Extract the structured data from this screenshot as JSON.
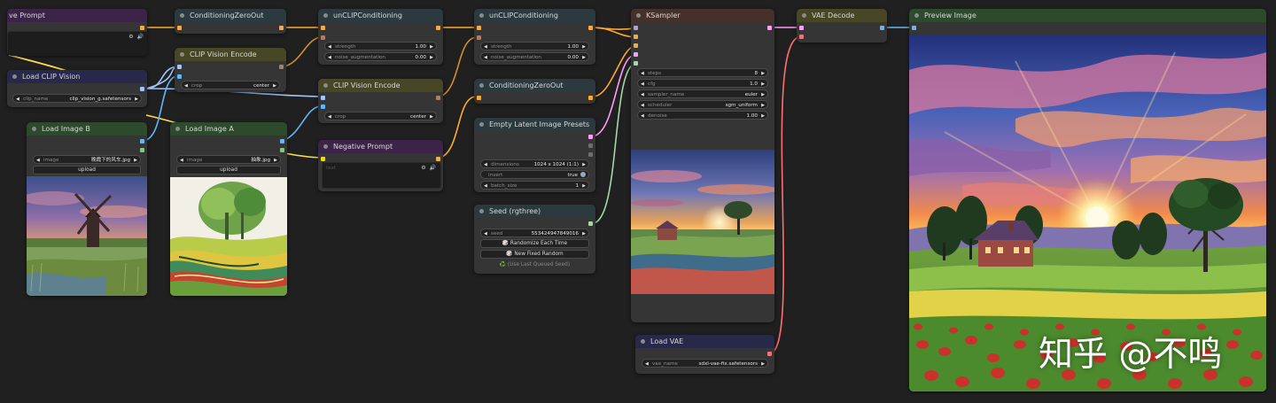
{
  "colors": {
    "canvas_bg": "#202020",
    "node_bg": "#353535",
    "wire_conditioning": "#ffa931",
    "wire_clip_vision": "#a1c5f5",
    "wire_image": "#64b5f6",
    "wire_latent": "#ff9cf9",
    "wire_vae": "#ff6e6e",
    "wire_int": "#a5d6a7",
    "wire_model": "#b39ddb"
  },
  "nodes": {
    "positive_prompt": {
      "title": "ve Prompt",
      "icons": "⚙ 🔊"
    },
    "load_clip_vision": {
      "title": "Load CLIP Vision",
      "clip_name_label": "clip_name",
      "clip_name_value": "clip_vision_g.safetensors"
    },
    "load_image_b": {
      "title": "Load Image B",
      "image_label": "image",
      "image_value": "晚霞下的风车.jpg",
      "upload_label": "upload"
    },
    "load_image_a": {
      "title": "Load Image A",
      "image_label": "image",
      "image_value": "抽象.jpg",
      "upload_label": "upload"
    },
    "conditioning_zero_out_1": {
      "title": "ConditioningZeroOut"
    },
    "clip_vision_encode_1": {
      "title": "CLIP Vision Encode",
      "crop_label": "crop",
      "crop_value": "center"
    },
    "unclip_conditioning_1": {
      "title": "unCLIPConditioning",
      "strength_label": "strength",
      "strength_value": "1.00",
      "noise_label": "noise_augmentation",
      "noise_value": "0.00"
    },
    "clip_vision_encode_2": {
      "title": "CLIP Vision Encode",
      "crop_label": "crop",
      "crop_value": "center"
    },
    "negative_prompt": {
      "title": "Negative Prompt",
      "placeholder": "text",
      "icons": "⚙ 🔊"
    },
    "unclip_conditioning_2": {
      "title": "unCLIPConditioning",
      "strength_label": "strength",
      "strength_value": "1.00",
      "noise_label": "noise_augmentation",
      "noise_value": "0.00"
    },
    "conditioning_zero_out_2": {
      "title": "ConditioningZeroOut"
    },
    "empty_latent": {
      "title": "Empty Latent Image Presets",
      "dimensions_label": "dimensions",
      "dimensions_value": "1024 x 1024 (1:1)",
      "invert_label": "invert",
      "invert_value": "true",
      "batch_label": "batch_size",
      "batch_value": "1"
    },
    "seed": {
      "title": "Seed (rgthree)",
      "seed_label": "seed",
      "seed_value": "553424947849016",
      "randomize_label": "🎲 Randomize Each Time",
      "fixed_label": "🎲 New Fixed Random",
      "last_label": "♻️ (Use Last Queued Seed)"
    },
    "ksampler": {
      "title": "KSampler",
      "steps_label": "steps",
      "steps_value": "8",
      "cfg_label": "cfg",
      "cfg_value": "1.0",
      "sampler_label": "sampler_name",
      "sampler_value": "euler",
      "scheduler_label": "scheduler",
      "scheduler_value": "sgm_uniform",
      "denoise_label": "denoise",
      "denoise_value": "1.00"
    },
    "load_vae": {
      "title": "Load VAE",
      "vae_label": "vae_name",
      "vae_value": "sdxl-vae-fix.safetensors"
    },
    "vae_decode": {
      "title": "VAE Decode"
    },
    "preview_image": {
      "title": "Preview Image",
      "watermark": "知乎 @不鸣"
    }
  }
}
